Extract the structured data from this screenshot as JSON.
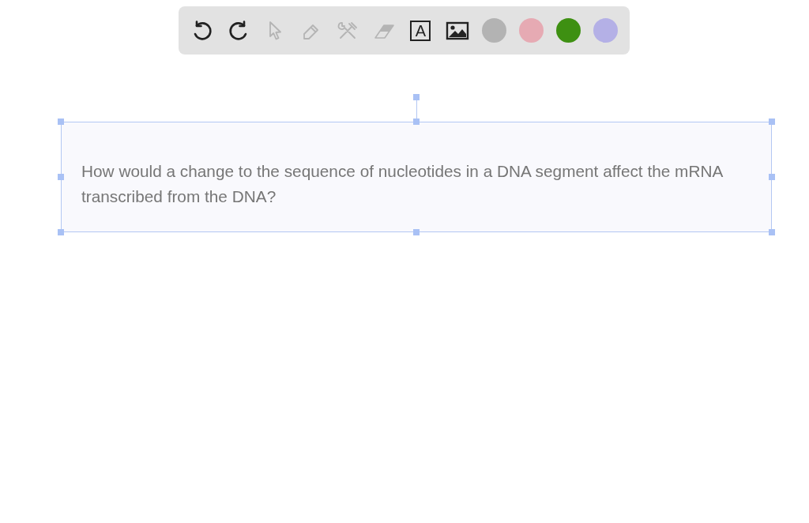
{
  "toolbar": {
    "tools": [
      {
        "kind": "undo",
        "disabled": false
      },
      {
        "kind": "redo",
        "disabled": false
      },
      {
        "kind": "pointer",
        "disabled": true
      },
      {
        "kind": "pen",
        "disabled": true
      },
      {
        "kind": "tools",
        "disabled": true
      },
      {
        "kind": "eraser",
        "disabled": true
      },
      {
        "kind": "text",
        "label": "A",
        "disabled": false
      },
      {
        "kind": "image",
        "disabled": false
      }
    ],
    "colors": [
      {
        "color": "#b3b3b3",
        "selected": false
      },
      {
        "color": "#e6aab3",
        "selected": false
      },
      {
        "color": "#3e9012",
        "selected": false
      },
      {
        "color": "#b4b0e6",
        "selected": false
      }
    ]
  },
  "text_box": {
    "selected": true,
    "text": "How would a change to the sequence of nucleotides in a DNA segment affect the mRNA transcribed from the DNA?"
  }
}
